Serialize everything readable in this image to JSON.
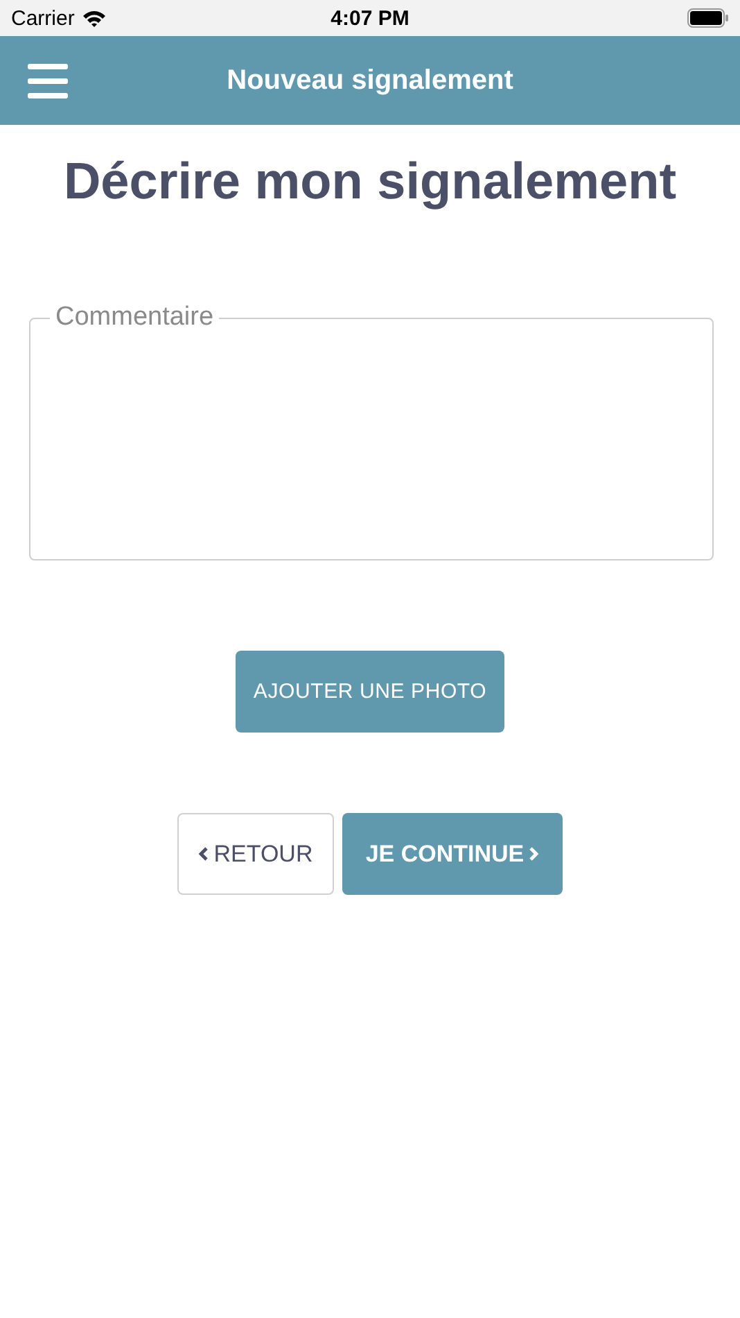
{
  "status_bar": {
    "carrier": "Carrier",
    "time": "4:07 PM"
  },
  "header": {
    "title": "Nouveau signalement"
  },
  "heading": "Décrire mon signalement",
  "comment_field": {
    "label": "Commentaire"
  },
  "photo_button": "AJOUTER UNE PHOTO",
  "nav_buttons": [
    {
      "kind": "back",
      "label": "RETOUR"
    },
    {
      "kind": "next",
      "label": "JE CONTINUE"
    }
  ]
}
